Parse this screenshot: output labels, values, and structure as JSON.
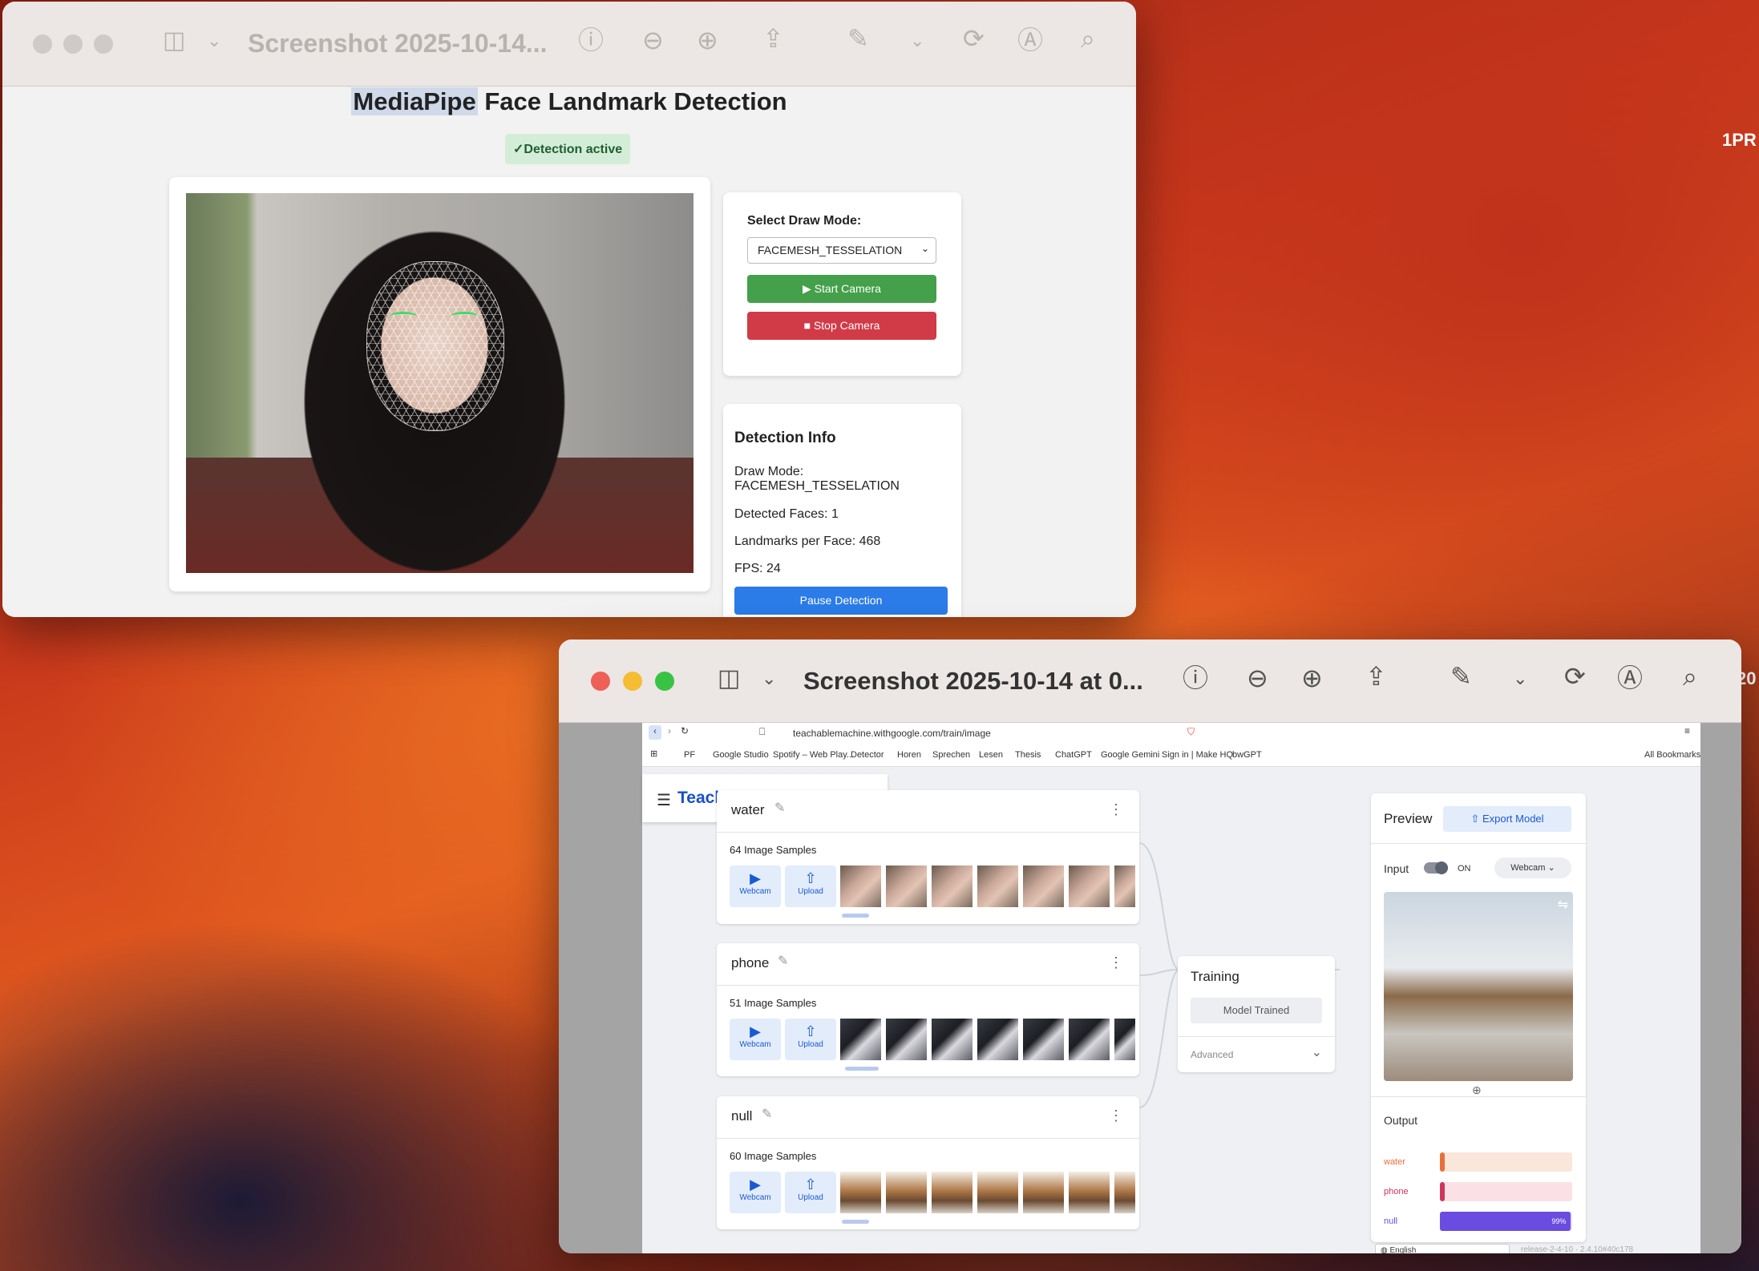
{
  "desktop": {
    "label_right_1": "1PR",
    "label_right_2": "20"
  },
  "window1": {
    "title": "Screenshot 2025-10-14...",
    "icons": [
      "sidebar-icon",
      "chevron-down-icon",
      "info-icon",
      "zoom-out-icon",
      "zoom-in-icon",
      "share-icon",
      "markup-pen-icon",
      "chevron-down-icon",
      "rotate-icon",
      "annotate-icon",
      "search-icon"
    ],
    "page": {
      "title_highlight": "MediaPipe",
      "title_rest": " Face Landmark Detection",
      "status_badge": "✓Detection active",
      "controls": {
        "select_label": "Select Draw Mode:",
        "select_value": "FACEMESH_TESSELATION",
        "start_label": "▶ Start Camera",
        "stop_label": "■ Stop Camera"
      },
      "info": {
        "heading": "Detection Info",
        "draw_mode_label": "Draw Mode:",
        "draw_mode_value": "FACEMESH_TESSELATION",
        "faces": "Detected Faces: 1",
        "landmarks": "Landmarks per Face: 468",
        "fps": "FPS: 24",
        "pause_label": "Pause Detection"
      }
    }
  },
  "window2": {
    "title": "Screenshot 2025-10-14 at 0...",
    "browser": {
      "url": "teachablemachine.withgoogle.com/train/image",
      "bookmarks": [
        "PF",
        "Google Studio",
        "Spotify – Web Play...",
        "Detector",
        "Horen",
        "Sprechen",
        "Lesen",
        "Thesis",
        "ChatGPT",
        "Google Gemini",
        "Sign in | Make HQ",
        "bwGPT"
      ],
      "all_bookmarks": "All Bookmarks"
    },
    "app": {
      "brand": "Teachable Machine",
      "classes": [
        {
          "name": "water",
          "count": "64 Image Samples",
          "webcam": "Webcam",
          "upload": "Upload"
        },
        {
          "name": "phone",
          "count": "51 Image Samples",
          "webcam": "Webcam",
          "upload": "Upload"
        },
        {
          "name": "null",
          "count": "60 Image Samples",
          "webcam": "Webcam",
          "upload": "Upload"
        }
      ],
      "training": {
        "title": "Training",
        "button": "Model Trained",
        "advanced": "Advanced"
      },
      "preview": {
        "title": "Preview",
        "export": "Export Model",
        "input_label": "Input",
        "toggle_state": "ON",
        "source": "Webcam",
        "output_label": "Output",
        "outputs": [
          {
            "name": "water",
            "color": "#e8703a",
            "track": "#fbe6dc",
            "percent": 0,
            "label": ""
          },
          {
            "name": "phone",
            "color": "#d0345a",
            "track": "#fbe1e6",
            "percent": 1,
            "label": ""
          },
          {
            "name": "null",
            "color": "#6a4ce0",
            "track": "#e6e0fb",
            "percent": 99,
            "label": "99%"
          }
        ]
      },
      "language": "English",
      "release": "release-2-4-10 · 2.4.10#40c178"
    }
  }
}
